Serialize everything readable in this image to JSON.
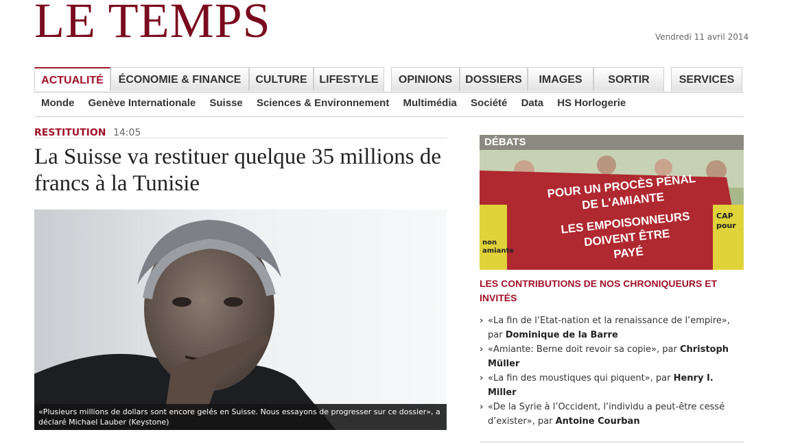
{
  "header": {
    "logo": "LE TEMPS",
    "date": "Vendredi 11 avril 2014"
  },
  "nav": {
    "tabs": [
      {
        "label": "ACTUALITÉ",
        "active": true
      },
      {
        "label": "ÉCONOMIE & FINANCE"
      },
      {
        "label": "CULTURE"
      },
      {
        "label": "LIFESTYLE"
      },
      {
        "label": "OPINIONS"
      },
      {
        "label": "DOSSIERS"
      },
      {
        "label": "IMAGES"
      },
      {
        "label": "SORTIR"
      },
      {
        "label": "SERVICES"
      }
    ],
    "subnav": [
      "Monde",
      "Genève Internationale",
      "Suisse",
      "Sciences & Environnement",
      "Multimédia",
      "Société",
      "Data",
      "HS Horlogerie"
    ]
  },
  "article": {
    "rubric": "RESTITUTION",
    "time": "14:05",
    "headline": "La Suisse va restituer quelque 35 millions de francs à la Tunisie",
    "caption": "«Plusieurs millions de dollars sont encore gelés en Suisse. Nous essayons de progresser sur ce dossier», a déclaré Michael Lauber (Keystone)"
  },
  "sidebar": {
    "debats_label": "DÉBATS",
    "banner_text": [
      "POUR UN PROCÈS PÉNAL",
      "DE L'AMIANTE",
      "LES EMPOISONNEURS",
      "DOIVENT ÊTRE",
      "PAYÉ"
    ],
    "sign_left": "non amiante",
    "sign_right": "CAP pour",
    "section_title": "LES CONTRIBUTIONS DE NOS CHRONIQUEURS ET INVITÉS",
    "contributions": [
      {
        "text": "«La fin de l’Etat-nation et la renaissance de l’empire», par ",
        "author": "Dominique de la Barre"
      },
      {
        "text": "«Amiante: Berne doit revoir sa copie», par ",
        "author": "Christoph Müller"
      },
      {
        "text": "«La fin des moustiques qui piquent», par ",
        "author": "Henry I. Miller"
      },
      {
        "text": "«De la Syrie à l’Occident, l’individu a peut-être cessé d’exister», par ",
        "author": "Antoine Courban"
      }
    ]
  },
  "colors": {
    "brand": "#7a0b1f",
    "accent": "#a01028",
    "debats_bar": "#8a8a80"
  }
}
